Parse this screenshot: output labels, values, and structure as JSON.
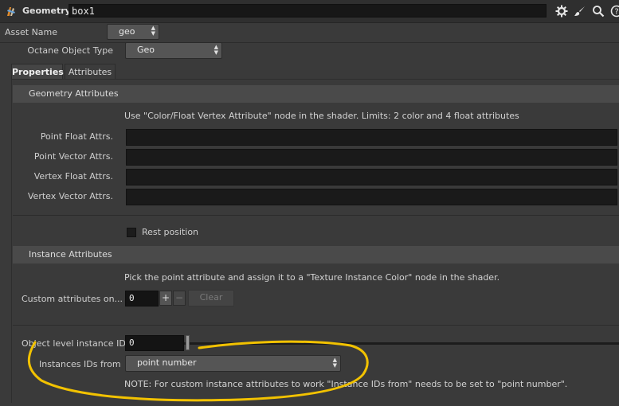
{
  "titlebar": {
    "node_type": "Geometry",
    "node_name": "box1",
    "icons": [
      "houdini-logo-icon",
      "gear-icon",
      "brush-icon",
      "search-icon",
      "help-icon"
    ]
  },
  "asset": {
    "label": "Asset Name",
    "value": "geo"
  },
  "object_type": {
    "label": "Octane Object Type",
    "value": "Geo"
  },
  "tabs": [
    {
      "label": "Properties",
      "active": true
    },
    {
      "label": "Attributes",
      "active": false
    }
  ],
  "geometry_attributes": {
    "header": "Geometry Attributes",
    "note": "Use \"Color/Float Vertex Attribute\" node in the shader. Limits: 2 color and 4 float attributes",
    "fields": [
      {
        "label": "Point Float Attrs.",
        "value": ""
      },
      {
        "label": "Point Vector Attrs.",
        "value": ""
      },
      {
        "label": "Vertex Float Attrs.",
        "value": ""
      },
      {
        "label": "Vertex Vector Attrs.",
        "value": ""
      }
    ],
    "rest_position": {
      "label": "Rest position",
      "checked": false
    }
  },
  "instance_attributes": {
    "header": "Instance Attributes",
    "note": "Pick the point attribute and assign it to a \"Texture Instance Color\" node in the shader.",
    "custom": {
      "label": "Custom attributes on...",
      "value": "0",
      "plus": "+",
      "minus": "−",
      "clear": "Clear"
    },
    "object_level_id": {
      "label": "Object level instance ID",
      "value": "0",
      "slider_fraction": 0
    },
    "instance_ids_from": {
      "label": "Instances IDs from",
      "value": "point number"
    },
    "footnote": "NOTE: For custom instance attributes to work \"Instance IDs from\" needs to be set to \"point number\"."
  },
  "colors": {
    "annotation": "#f2c200",
    "background": "#3a3a3a",
    "section_header": "#4a4a4a"
  }
}
